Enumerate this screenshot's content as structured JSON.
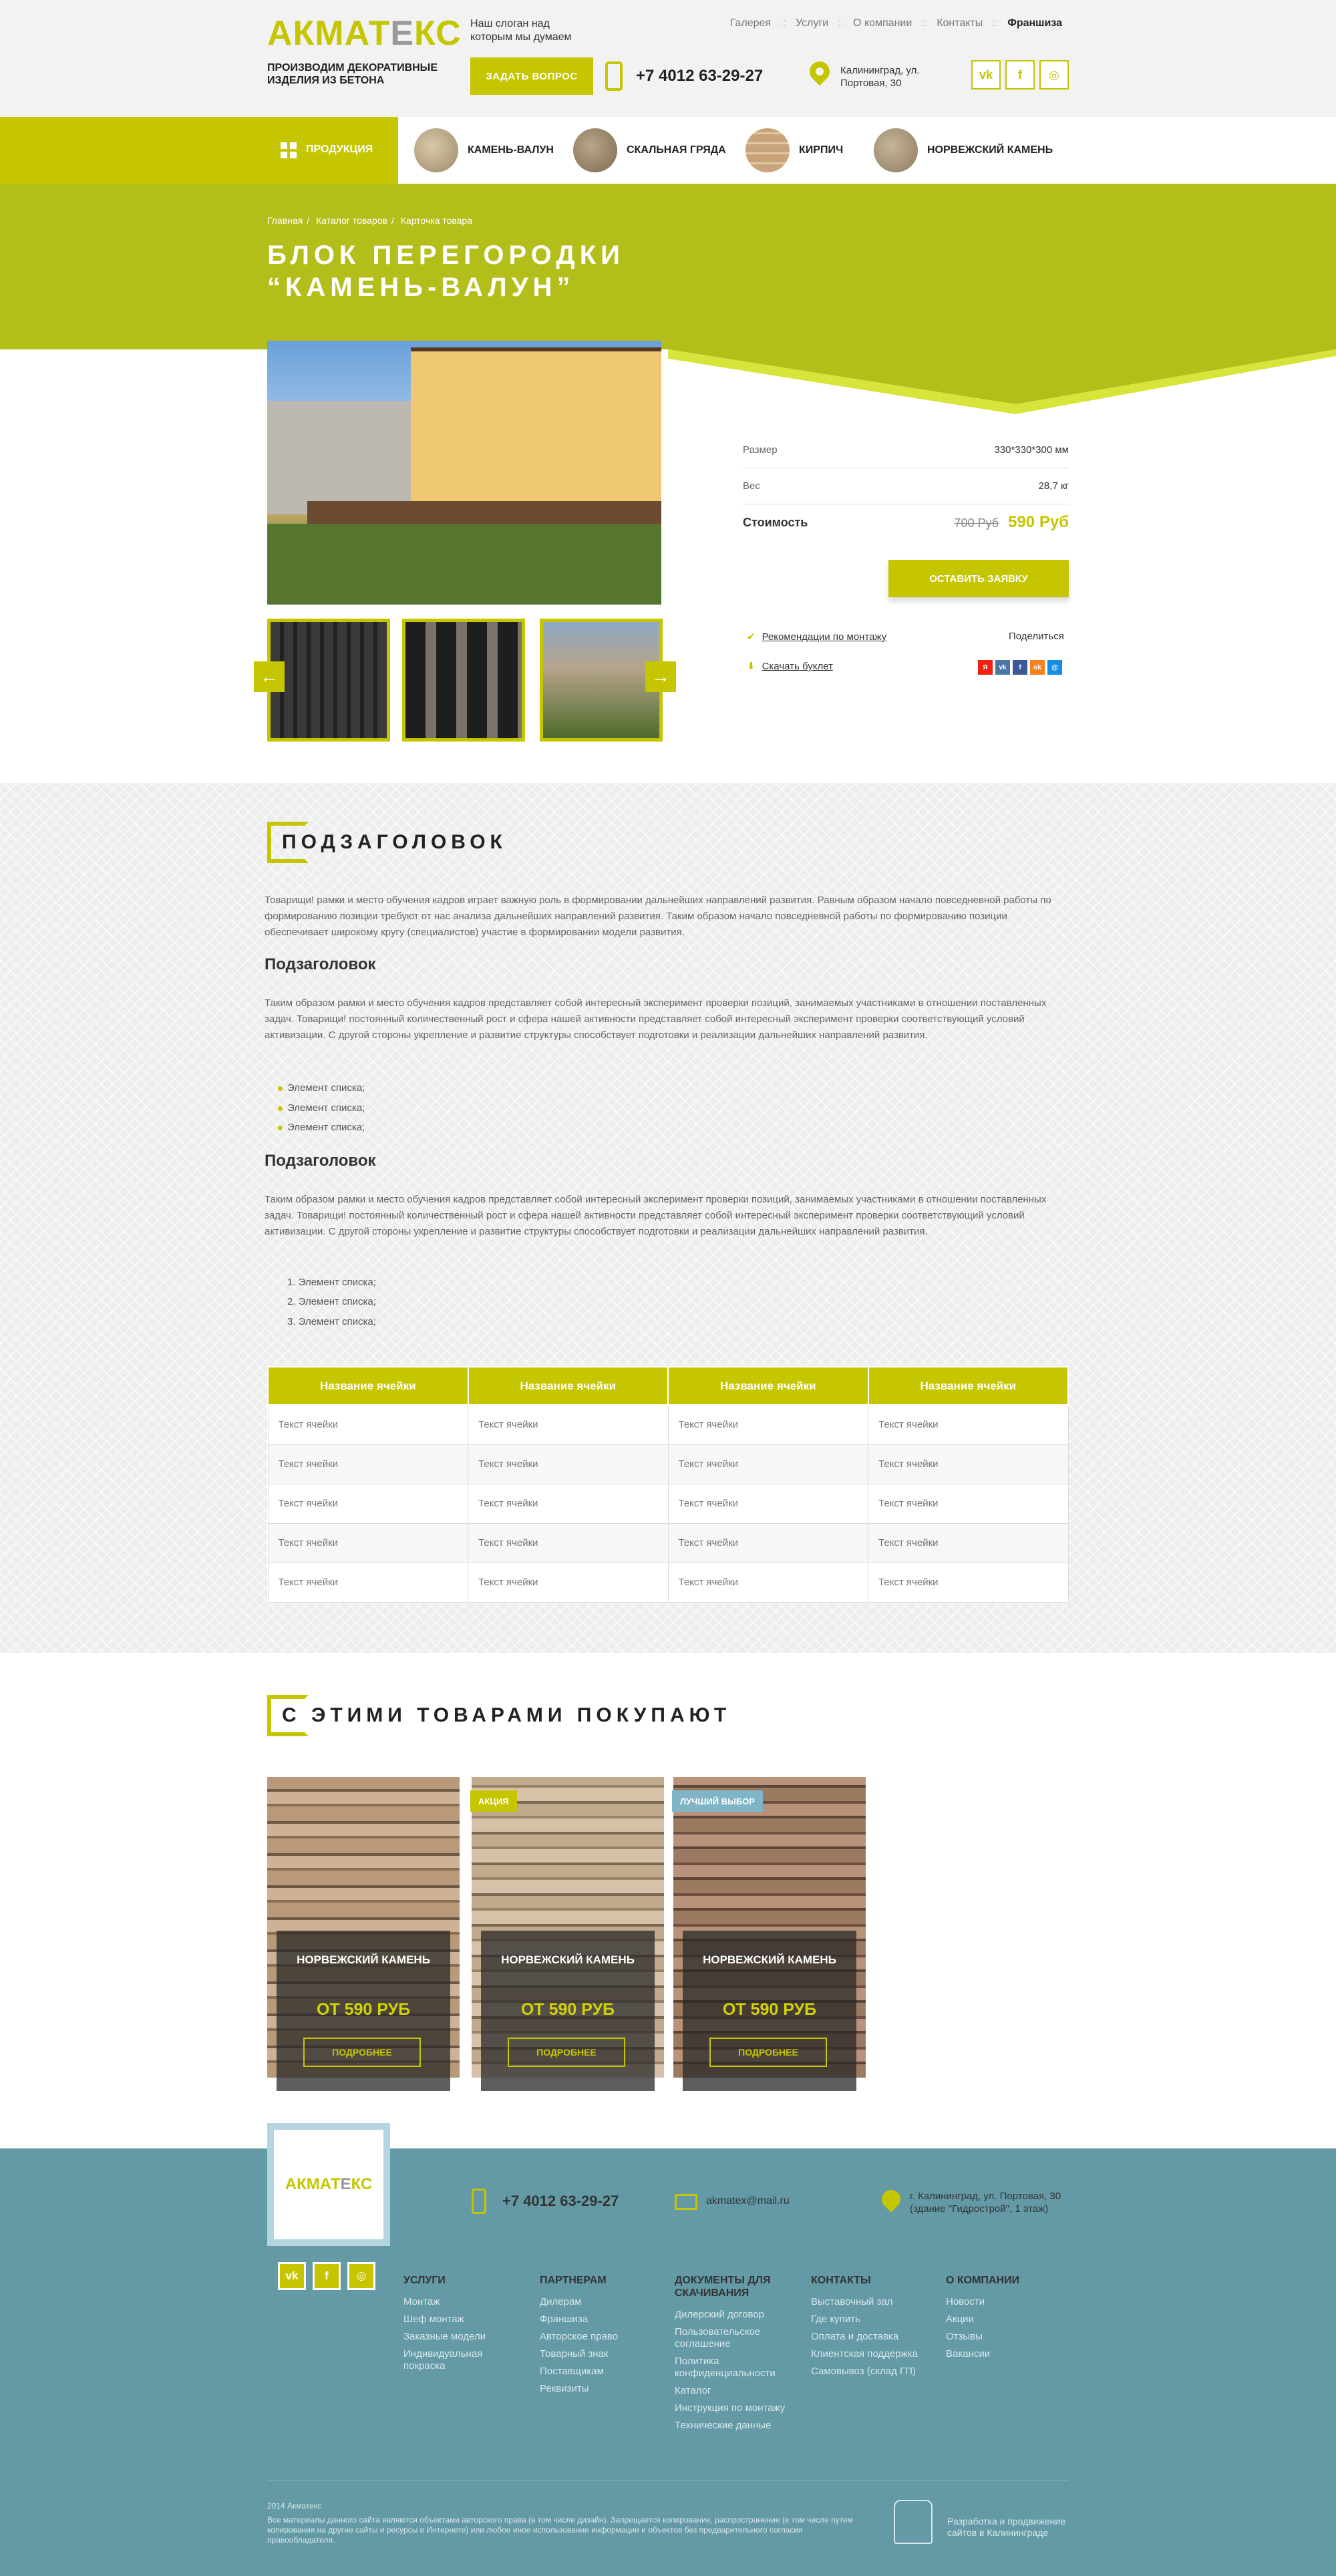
{
  "header": {
    "logo": "АКМАТЕКС",
    "slogan": "Наш слоган над которым мы думаем",
    "nav": [
      "Галерея",
      "Услуги",
      "О компании",
      "Контакты",
      "Франшиза"
    ],
    "tagline": "ПРОИЗВОДИМ ДЕКОРАТИВНЫЕ ИЗДЕЛИЯ ИЗ БЕТОНА",
    "ask_button": "ЗАДАТЬ ВОПРОС",
    "phone": "+7 4012 63-29-27",
    "address": "Калининград, ул. Портовая, 30",
    "social": [
      "vk-icon",
      "facebook-icon",
      "instagram-icon"
    ]
  },
  "categories": {
    "products_label": "ПРОДУКЦИЯ",
    "items": [
      "КАМЕНЬ-ВАЛУН",
      "СКАЛЬНАЯ ГРЯДА",
      "КИРПИЧ",
      "НОРВЕЖСКИЙ КАМЕНЬ"
    ]
  },
  "breadcrumbs": [
    "Главная",
    "Каталог товаров",
    "Карточка товара"
  ],
  "product": {
    "title": "БЛОК ПЕРЕГОРОДКИ “КАМЕНЬ-ВАЛУН”",
    "specs": [
      {
        "label": "Размер",
        "value": "330*330*300 мм"
      },
      {
        "label": "Вес",
        "value": "28,7 кг"
      }
    ],
    "price_label": "Стоимость",
    "price_old": "700 Руб",
    "price_new": "590 Руб",
    "order_button": "ОСТАВИТЬ ЗАЯВКУ",
    "install_link": "Рекомендации по монтажу",
    "download_link": "Скачать буклет",
    "share_label": "Поделиться",
    "share_icons": [
      "yandex-icon",
      "vk-icon",
      "facebook-icon",
      "odnoklassniki-icon",
      "mailru-icon"
    ]
  },
  "content": {
    "heading": "ПОДЗАГОЛОВОК",
    "p1": "Товарищи! рамки и место обучения кадров играет важную роль в формировании дальнейших направлений развития. Равным образом начало повседневной работы по формированию позиции требуют от нас анализа дальнейших направлений развития. Таким образом начало повседневной работы по формированию позиции обеспечивает широкому кругу (специалистов) участие в формировании модели развития.",
    "sub1": "Подзаголовок",
    "p2": "Таким образом рамки и место обучения кадров представляет собой интересный эксперимент проверки позиций, занимаемых участниками в отношении поставленных задач. Товарищи! постоянный количественный рост и сфера нашей активности представляет собой интересный эксперимент проверки соответствующий условий активизации. С другой стороны укрепление и развитие структуры способствует подготовки и реализации дальнейших направлений развития.",
    "ul": [
      "Элемент списка;",
      "Элемент списка;",
      "Элемент списка;"
    ],
    "sub2": "Подзаголовок",
    "p3": "Таким образом рамки и место обучения кадров представляет собой интересный эксперимент проверки позиций, занимаемых участниками в отношении поставленных задач. Товарищи! постоянный количественный рост и сфера нашей активности представляет собой интересный эксперимент проверки соответствующий условий активизации. С другой стороны укрепление и развитие структуры способствует подготовки и реализации дальнейших направлений развития.",
    "ol": [
      "1. Элемент списка;",
      "2. Элемент списка;",
      "3. Элемент списка;"
    ],
    "table": {
      "headers": [
        "Название ячейки",
        "Название ячейки",
        "Название ячейки",
        "Название ячейки"
      ],
      "cell": "Текст ячейки",
      "rows": 5
    }
  },
  "related": {
    "heading": "С ЭТИМИ ТОВАРАМИ ПОКУПАЮТ",
    "cards": [
      {
        "name": "НОРВЕЖСКИЙ КАМЕНЬ",
        "price": "ОТ 590 РУБ",
        "button": "ПОДРОБНЕЕ",
        "badge": ""
      },
      {
        "name": "НОРВЕЖСКИЙ КАМЕНЬ",
        "price": "ОТ 590 РУБ",
        "button": "ПОДРОБНЕЕ",
        "badge": "АКЦИЯ"
      },
      {
        "name": "НОРВЕЖСКИЙ КАМЕНЬ",
        "price": "ОТ 590 РУБ",
        "button": "ПОДРОБНЕЕ",
        "badge": "ЛУЧШИЙ ВЫБОР"
      }
    ]
  },
  "footer": {
    "logo": "АКМАТЕКС",
    "phone": "+7 4012 63-29-27",
    "email": "akmatex@mail.ru",
    "address": "г. Калининград, ул. Портовая, 30 (здание \"Гидрострой\", 1 этаж)",
    "columns": [
      {
        "title": "УСЛУГИ",
        "items": [
          "Монтаж",
          "Шеф монтаж",
          "Заказные модели",
          "Индивидуальная покраска"
        ]
      },
      {
        "title": "ПАРТНЕРАМ",
        "items": [
          "Дилерам",
          "Франшиза",
          "Авторское право",
          "Товарный знак",
          "Поставщикам",
          "Реквизиты"
        ]
      },
      {
        "title": "ДОКУМЕНТЫ ДЛЯ СКАЧИВАНИЯ",
        "items": [
          "Дилерский договор",
          "Пользовательское соглашение",
          "Политика конфиденциальности",
          "Каталог",
          "Инструкция по монтажу",
          "Технические данные"
        ]
      },
      {
        "title": "КОНТАКТЫ",
        "items": [
          "Выставочный зал",
          "Где купить",
          "Оплата и доставка",
          "Клиентская поддержка",
          "Самовывоз (склад ГП)"
        ]
      },
      {
        "title": "О КОМПАНИИ",
        "items": [
          "Новости",
          "Акции",
          "Отзывы",
          "Вакансии"
        ]
      }
    ],
    "copyright": "2014 Акматекс",
    "legal": "Все материалы данного сайта являются объектами авторского права (в том числе дизайн). Запрещается копирование, распространение (в том числе путем копирования на другие сайты и ресурсы в Интернете) или любое иное использование информации и объектов без предварительного согласия правообладателя.",
    "developer": "Разработка и продвижение сайтов в Калининграде"
  },
  "colors": {
    "accent": "#c5c500",
    "hero": "#b4be1a",
    "footer": "#6499a6"
  }
}
